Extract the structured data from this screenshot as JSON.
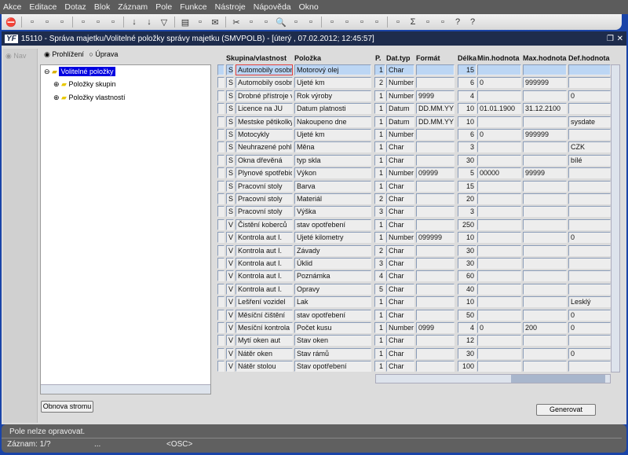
{
  "menu": [
    "Akce",
    "Editace",
    "Dotaz",
    "Blok",
    "Záznam",
    "Pole",
    "Funkce",
    "Nástroje",
    "Nápověda",
    "Okno"
  ],
  "toolbar_icons": [
    "exit-icon",
    "insert-icon",
    "delete-icon",
    "clear-icon",
    "query-icon",
    "execute-query-icon",
    "cancel-query-icon",
    "sort-asc-icon",
    "sort-desc-icon",
    "filter-icon",
    "print-icon",
    "print-setup-icon",
    "mail-icon",
    "cut-icon",
    "copy-icon",
    "paste-icon",
    "search-icon",
    "indent-icon",
    "columns-icon",
    "calendar-icon",
    "report-icon",
    "network-icon",
    "triangle-icon",
    "chart-icon",
    "sum-icon",
    "excel-icon",
    "browser-icon",
    "help-icon",
    "context-help-icon"
  ],
  "window": {
    "title": "15110 - Správa majetku/Volitelné položky správy majetku (SMVPOLB) - [úterý  , 07.02.2012; 12:45:57]"
  },
  "nav": {
    "label": "Nav"
  },
  "mode": {
    "browse": "Prohlížení",
    "edit": "Úprava",
    "selected": "browse"
  },
  "tree": {
    "root": "Volitelné položky",
    "children": [
      "Položky skupin",
      "Položky vlastností"
    ]
  },
  "buttons": {
    "refresh_tree": "Obnova stromu",
    "generate": "Generovat"
  },
  "grid": {
    "headers": [
      "Skupina/vlastnost",
      "Položka",
      "P.",
      "Dat.typ",
      "Formát",
      "Délka",
      "Min.hodnota",
      "Max.hodnota",
      "Def.hodnota"
    ],
    "rows": [
      [
        "SI",
        "Automobily osobní",
        "Motorový olej",
        "1",
        "Char",
        "",
        "15",
        "",
        "",
        ""
      ],
      [
        "SI",
        "Automobily osobní",
        "Ujeté km",
        "2",
        "Number",
        "",
        "6",
        "0",
        "999999",
        ""
      ],
      [
        "SI",
        "Drobné přístroje v l",
        "Rok výroby",
        "1",
        "Number",
        "9999",
        "4",
        "",
        "",
        "0"
      ],
      [
        "SI",
        "Licence na JU",
        "Datum platnosti",
        "1",
        "Datum",
        "DD.MM.YYYY",
        "10",
        "01.01.1900",
        "31.12.2100",
        ""
      ],
      [
        "SI",
        "Mestske pětikolky",
        "Nakoupeno dne",
        "1",
        "Datum",
        "DD.MM.YYYY",
        "10",
        "",
        "",
        "sysdate"
      ],
      [
        "SI",
        "Motocykly",
        "Ujeté km",
        "1",
        "Number",
        "",
        "6",
        "0",
        "999999",
        ""
      ],
      [
        "SI",
        "Neuhrazené pohled",
        "Měna",
        "1",
        "Char",
        "",
        "3",
        "",
        "",
        "CZK"
      ],
      [
        "SI",
        "Okna dřevěná",
        "typ skla",
        "1",
        "Char",
        "",
        "30",
        "",
        "",
        "bílé"
      ],
      [
        "SI",
        "Plynové spotřebice",
        "Výkon",
        "1",
        "Number",
        "09999",
        "5",
        "00000",
        "99999",
        ""
      ],
      [
        "SI",
        "Pracovní stoly",
        "Barva",
        "1",
        "Char",
        "",
        "15",
        "",
        "",
        ""
      ],
      [
        "SI",
        "Pracovní stoly",
        "Materiál",
        "2",
        "Char",
        "",
        "20",
        "",
        "",
        ""
      ],
      [
        "SI",
        "Pracovní stoly",
        "Výška",
        "3",
        "Char",
        "",
        "3",
        "",
        "",
        ""
      ],
      [
        "V",
        "Čistění koberců",
        "stav opotřebení",
        "1",
        "Char",
        "",
        "250",
        "",
        "",
        ""
      ],
      [
        "V",
        "Kontrola aut I.",
        "Ujeté kilometry",
        "1",
        "Number",
        "099999",
        "10",
        "",
        "",
        "0"
      ],
      [
        "V",
        "Kontrola aut I.",
        "Závady",
        "2",
        "Char",
        "",
        "30",
        "",
        "",
        ""
      ],
      [
        "V",
        "Kontrola aut I.",
        "Úklid",
        "3",
        "Char",
        "",
        "30",
        "",
        "",
        ""
      ],
      [
        "V",
        "Kontrola aut I.",
        "Poznámka",
        "4",
        "Char",
        "",
        "60",
        "",
        "",
        ""
      ],
      [
        "V",
        "Kontrola aut I.",
        "Opravy",
        "5",
        "Char",
        "",
        "40",
        "",
        "",
        ""
      ],
      [
        "V",
        "Lešření vozidel",
        "Lak",
        "1",
        "Char",
        "",
        "10",
        "",
        "",
        "Lesklý"
      ],
      [
        "V",
        "Měsíční čištění",
        "stav opotřebení",
        "1",
        "Char",
        "",
        "50",
        "",
        "",
        "0"
      ],
      [
        "V",
        "Mesíční kontrola",
        "Počet kusu",
        "1",
        "Number",
        "0999",
        "4",
        "0",
        "200",
        "0"
      ],
      [
        "V",
        "Mytí oken aut",
        "Stav oken",
        "1",
        "Char",
        "",
        "12",
        "",
        "",
        ""
      ],
      [
        "V",
        "Nátěr oken",
        "Stav rámů",
        "1",
        "Char",
        "",
        "30",
        "",
        "",
        "0"
      ],
      [
        "V",
        "Nátěr stolou",
        "Stav opotřebení",
        "1",
        "Char",
        "",
        "100",
        "",
        "",
        ""
      ]
    ]
  },
  "status": {
    "message": "Pole nelze opravovat.",
    "record": "Záznam: 1/?",
    "ellipsis": "...",
    "mode": "<OSC>"
  }
}
